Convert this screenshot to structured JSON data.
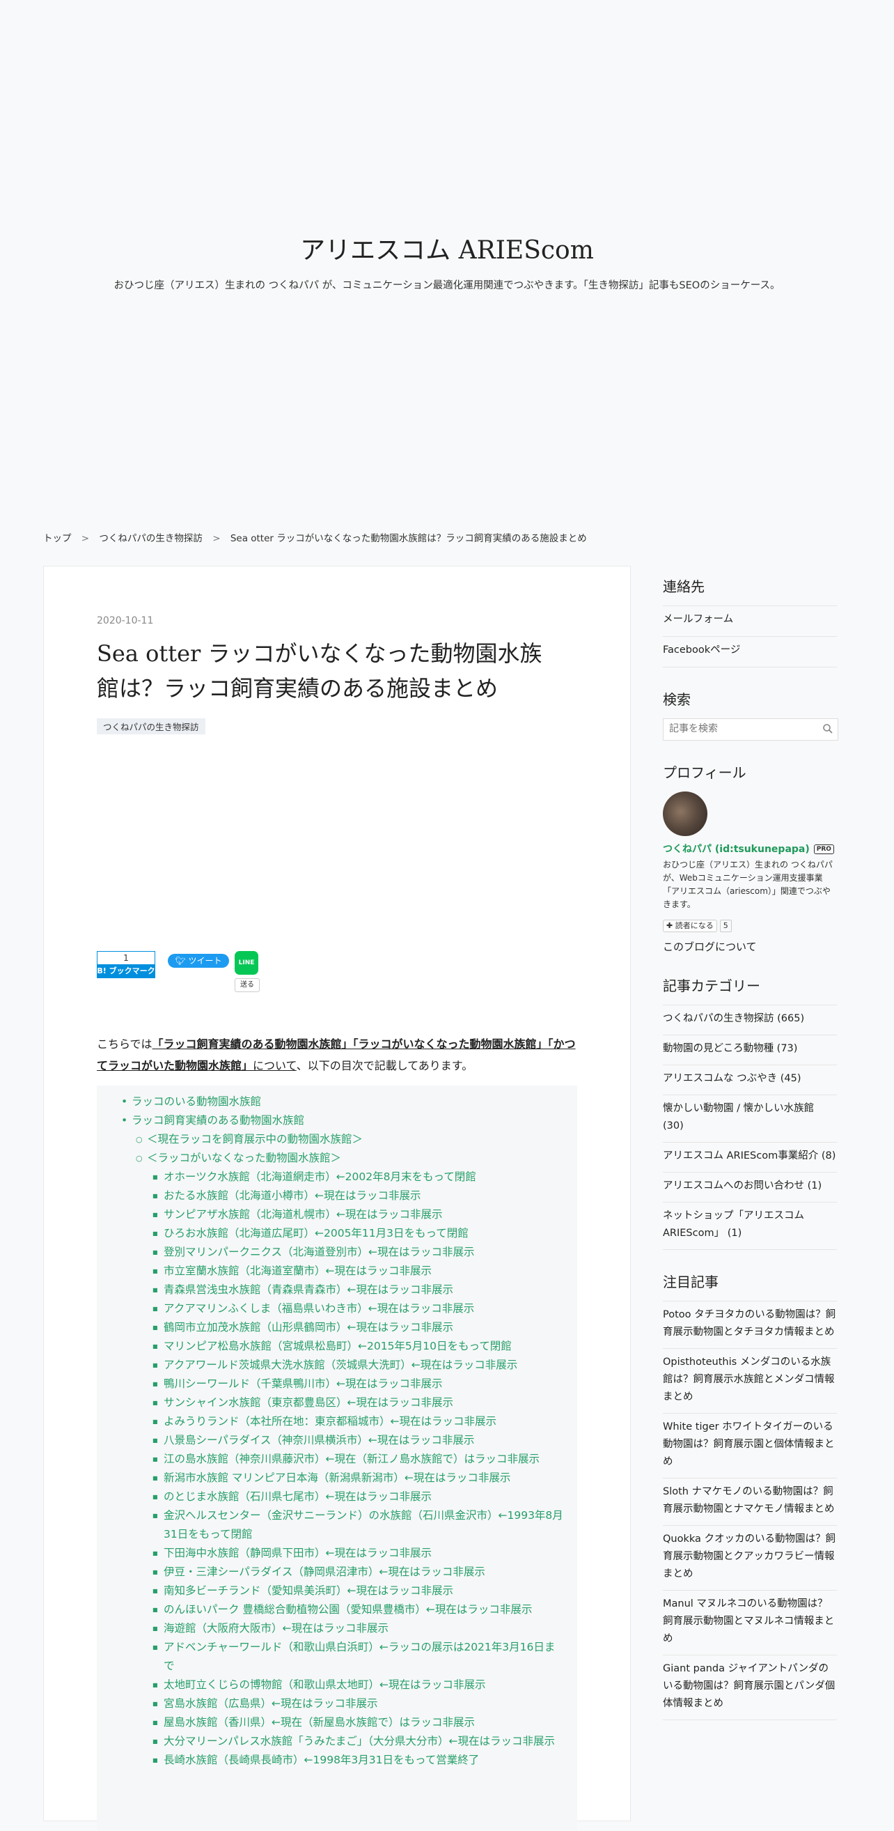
{
  "header": {
    "site_title": "アリエスコム ARIEScom",
    "site_description": "おひつじ座（アリエス）生まれの つくねパパ が、コミュニケーション最適化運用関連でつぶやきます。「生き物探訪」記事もSEOのショーケース。"
  },
  "breadcrumb": {
    "items": [
      "トップ",
      "つくねパパの生き物探訪",
      "Sea otter ラッコがいなくなった動物園水族館は？ラッコ飼育実績のある施設まとめ"
    ],
    "separator": ">"
  },
  "entry": {
    "date": "2020-10-11",
    "title": "Sea otter ラッコがいなくなった動物園水族館は？ラッコ飼育実績のある施設まとめ",
    "category": "つくねパパの生き物探訪",
    "share": {
      "hatena_count": "1",
      "hatena_label": "B! ブックマーク",
      "tweet_label": "ツイート",
      "line_icon": "LINE",
      "line_label": "送る"
    },
    "intro": {
      "prefix": "こちらでは",
      "link_text": "「ラッコ飼育実績のある動物園水族館」「ラッコがいなくなった動物園水族館」「かつてラッコがいた動物園水族館」",
      "link_suffix": "について",
      "suffix": "、以下の目次で記載してあります。"
    },
    "toc": [
      {
        "level": 1,
        "text": "ラッコのいる動物園水族館"
      },
      {
        "level": 1,
        "text": "ラッコ飼育実績のある動物園水族館"
      },
      {
        "level": 2,
        "text": "＜現在ラッコを飼育展示中の動物園水族館＞"
      },
      {
        "level": 2,
        "text": "＜ラッコがいなくなった動物園水族館＞"
      },
      {
        "level": 3,
        "text": "オホーツク水族館（北海道網走市）←2002年8月末をもって閉館"
      },
      {
        "level": 3,
        "text": "おたる水族館（北海道小樽市）←現在はラッコ非展示"
      },
      {
        "level": 3,
        "text": "サンピアザ水族館（北海道札幌市）←現在はラッコ非展示"
      },
      {
        "level": 3,
        "text": "ひろお水族館（北海道広尾町）←2005年11月3日をもって閉館"
      },
      {
        "level": 3,
        "text": "登別マリンパークニクス（北海道登別市）←現在はラッコ非展示"
      },
      {
        "level": 3,
        "text": "市立室蘭水族館（北海道室蘭市）←現在はラッコ非展示"
      },
      {
        "level": 3,
        "text": "青森県営浅虫水族館（青森県青森市）←現在はラッコ非展示"
      },
      {
        "level": 3,
        "text": "アクアマリンふくしま（福島県いわき市）←現在はラッコ非展示"
      },
      {
        "level": 3,
        "text": "鶴岡市立加茂水族館（山形県鶴岡市）←現在はラッコ非展示"
      },
      {
        "level": 3,
        "text": "マリンピア松島水族館（宮城県松島町）←2015年5月10日をもって閉館"
      },
      {
        "level": 3,
        "text": "アクアワールド茨城県大洗水族館（茨城県大洗町）←現在はラッコ非展示"
      },
      {
        "level": 3,
        "text": "鴨川シーワールド（千葉県鴨川市）←現在はラッコ非展示"
      },
      {
        "level": 3,
        "text": "サンシャイン水族館（東京都豊島区）←現在はラッコ非展示"
      },
      {
        "level": 3,
        "text": "よみうりランド（本社所在地：東京都稲城市）←現在はラッコ非展示"
      },
      {
        "level": 3,
        "text": "八景島シーパラダイス（神奈川県横浜市）←現在はラッコ非展示"
      },
      {
        "level": 3,
        "text": "江の島水族館（神奈川県藤沢市）←現在（新江ノ島水族館で）はラッコ非展示"
      },
      {
        "level": 3,
        "text": "新潟市水族館 マリンピア日本海（新潟県新潟市）←現在はラッコ非展示"
      },
      {
        "level": 3,
        "text": "のとじま水族館（石川県七尾市）←現在はラッコ非展示"
      },
      {
        "level": 3,
        "text": "金沢ヘルスセンター（金沢サニーランド）の水族館（石川県金沢市）←1993年8月31日をもって閉館"
      },
      {
        "level": 3,
        "text": "下田海中水族館（静岡県下田市）←現在はラッコ非展示"
      },
      {
        "level": 3,
        "text": "伊豆・三津シーパラダイス（静岡県沼津市）←現在はラッコ非展示"
      },
      {
        "level": 3,
        "text": "南知多ビーチランド（愛知県美浜町）←現在はラッコ非展示"
      },
      {
        "level": 3,
        "text": "のんほいパーク 豊橋総合動植物公園（愛知県豊橋市）←現在はラッコ非展示"
      },
      {
        "level": 3,
        "text": "海遊館（大阪府大阪市）←現在はラッコ非展示"
      },
      {
        "level": 3,
        "text": "アドベンチャーワールド（和歌山県白浜町）←ラッコの展示は2021年3月16日まで"
      },
      {
        "level": 3,
        "text": "太地町立くじらの博物館（和歌山県太地町）←現在はラッコ非展示"
      },
      {
        "level": 3,
        "text": "宮島水族館（広島県）←現在はラッコ非展示"
      },
      {
        "level": 3,
        "text": "屋島水族館（香川県）←現在（新屋島水族館で）はラッコ非展示"
      },
      {
        "level": 3,
        "text": "大分マリーンパレス水族館「うみたまご」（大分県大分市）←現在はラッコ非展示"
      },
      {
        "level": 3,
        "text": "長崎水族館（長崎県長崎市）←1998年3月31日をもって営業終了"
      }
    ]
  },
  "sidebar": {
    "contact": {
      "heading": "連絡先",
      "items": [
        "メールフォーム",
        "Facebookページ"
      ]
    },
    "search": {
      "heading": "検索",
      "placeholder": "記事を検索"
    },
    "profile": {
      "heading": "プロフィール",
      "name": "つくねパパ (id:tsukunepapa)",
      "badge": "PRO",
      "description": "おひつじ座（アリエス）生まれの つくねパパが、Webコミュニケーション運用支援事業「アリエスコム（ariescom）」関連でつぶやきます。",
      "reader_button": "読者になる",
      "reader_count": "5",
      "about_link": "このブログについて"
    },
    "categories": {
      "heading": "記事カテゴリー",
      "items": [
        "つくねパパの生き物探訪 (665)",
        "動物園の見どころ動物種 (73)",
        "アリエスコムな つぶやき (45)",
        "懐かしい動物園 / 懐かしい水族館 (30)",
        "アリエスコム ARIEScom事業紹介 (8)",
        "アリエスコムへのお問い合わせ (1)",
        "ネットショップ「アリエスコム ARIEScom」 (1)"
      ]
    },
    "featured": {
      "heading": "注目記事",
      "items": [
        "Potoo タチヨタカのいる動物園は？飼育展示動物園とタチヨタカ情報まとめ",
        "Opisthoteuthis メンダコのいる水族館は？飼育展示水族館とメンダコ情報まとめ",
        "White tiger ホワイトタイガーのいる動物園は？飼育展示園と個体情報まとめ",
        "Sloth ナマケモノのいる動物園は？飼育展示動物園とナマケモノ情報まとめ",
        "Quokka クオッカのいる動物園は？飼育展示動物園とクアッカワラビー情報まとめ",
        "Manul マヌルネコのいる動物園は？飼育展示動物園とマヌルネコ情報まとめ",
        "Giant panda ジャイアントパンダのいる動物園は？飼育展示園とパンダ個体情報まとめ"
      ]
    }
  }
}
